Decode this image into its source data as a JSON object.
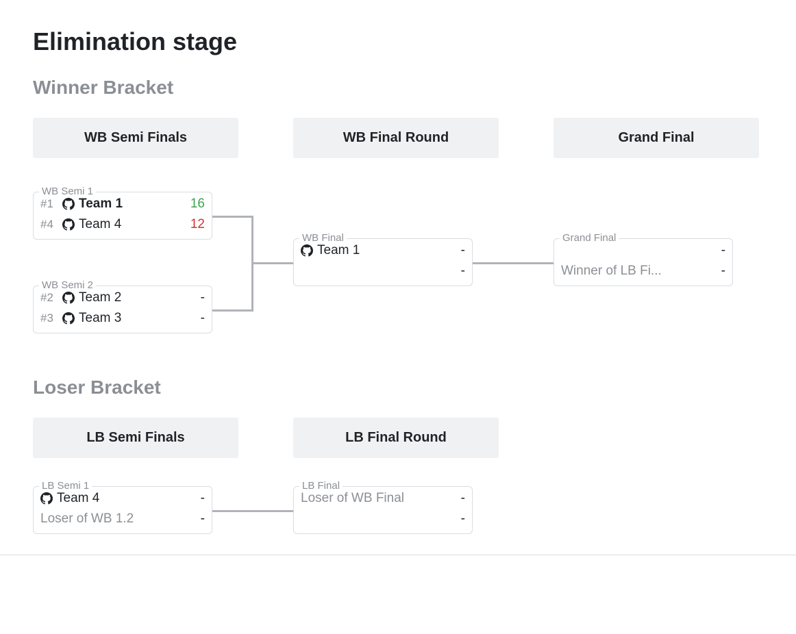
{
  "page_title": "Elimination stage",
  "winner_bracket": {
    "title": "Winner Bracket",
    "rounds": {
      "semi": "WB Semi Finals",
      "final": "WB Final Round",
      "grand": "Grand Final"
    },
    "matches": {
      "semi1": {
        "title": "WB Semi 1",
        "team_a": {
          "seed": "#1",
          "name": "Team 1",
          "score": "16",
          "winner": true
        },
        "team_b": {
          "seed": "#4",
          "name": "Team 4",
          "score": "12",
          "winner": false
        }
      },
      "semi2": {
        "title": "WB Semi 2",
        "team_a": {
          "seed": "#2",
          "name": "Team 2",
          "score": "-"
        },
        "team_b": {
          "seed": "#3",
          "name": "Team 3",
          "score": "-"
        }
      },
      "final": {
        "title": "WB Final",
        "team_a": {
          "name": "Team 1",
          "score": "-"
        },
        "team_b": {
          "name": "",
          "score": "-"
        }
      },
      "grand": {
        "title": "Grand Final",
        "team_a": {
          "name": "",
          "score": "-"
        },
        "team_b": {
          "name": "Winner of LB Fi...",
          "score": "-",
          "placeholder": true
        }
      }
    }
  },
  "loser_bracket": {
    "title": "Loser Bracket",
    "rounds": {
      "semi": "LB Semi Finals",
      "final": "LB Final Round"
    },
    "matches": {
      "semi1": {
        "title": "LB Semi 1",
        "team_a": {
          "name": "Team 4",
          "score": "-"
        },
        "team_b": {
          "name": "Loser of WB 1.2",
          "score": "-",
          "placeholder": true
        }
      },
      "final": {
        "title": "LB Final",
        "team_a": {
          "name": "Loser of WB Final",
          "score": "-",
          "placeholder": true
        },
        "team_b": {
          "name": "",
          "score": "-"
        }
      }
    }
  }
}
